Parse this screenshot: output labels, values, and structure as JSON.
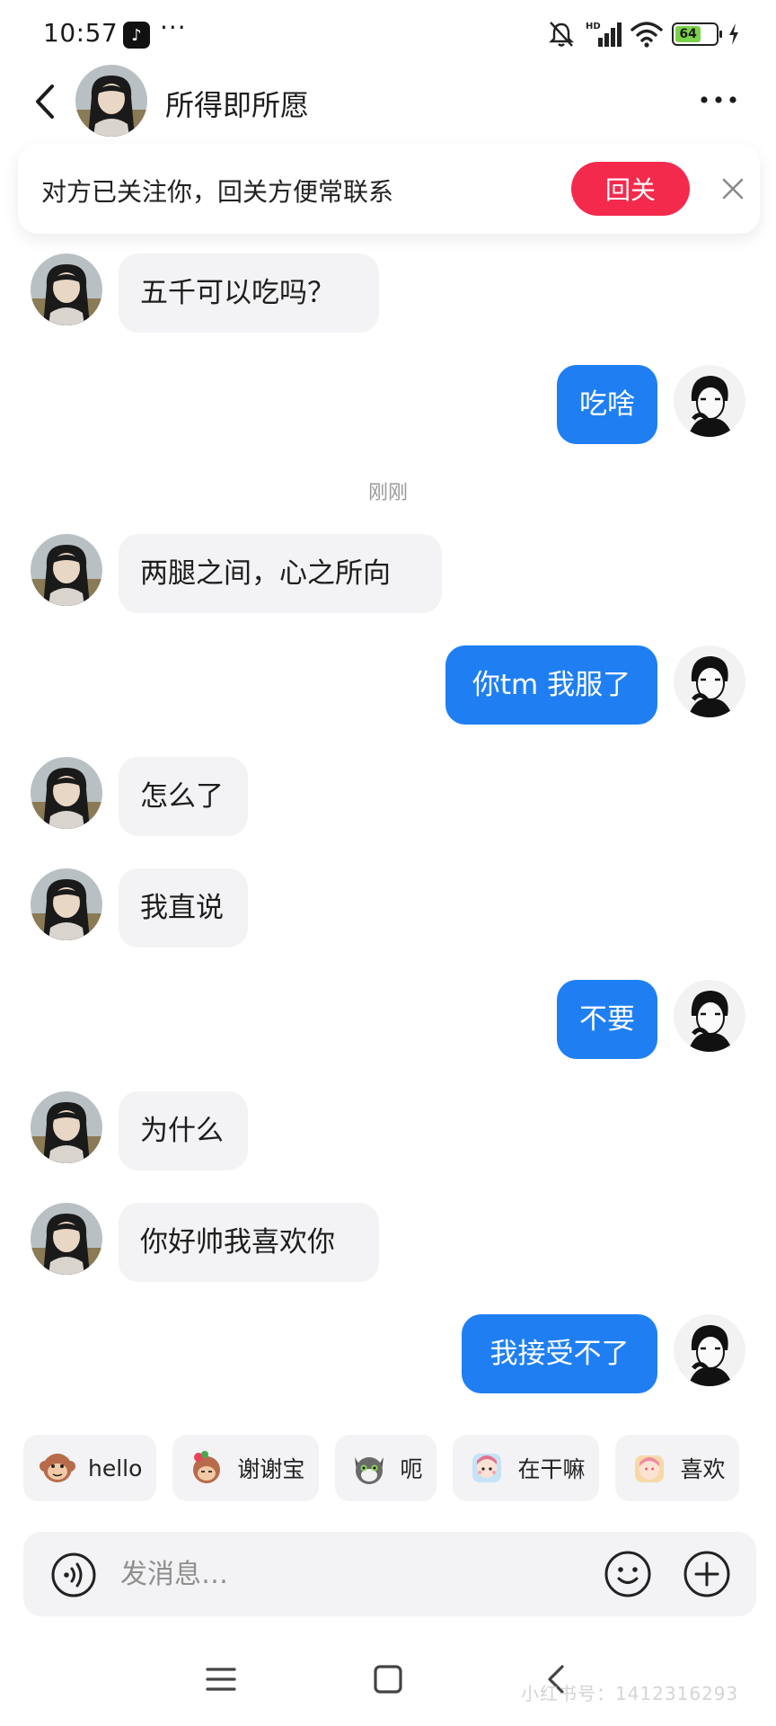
{
  "status_bar": {
    "time": "10:57",
    "app_badge": "♪",
    "more": "···",
    "network": "HD",
    "battery": "64",
    "battery_level": 0.64
  },
  "header": {
    "contact_name": "所得即所愿"
  },
  "follow_banner": {
    "text": "对方已关注你，回关方便常联系",
    "button_label": "回关",
    "accent_color": "#f42a4d"
  },
  "messages": [
    {
      "from": "them",
      "text": "五千可以吃吗？"
    },
    {
      "from": "me",
      "text": "吃啥"
    },
    {
      "from": "them",
      "text": "两腿之间，心之所向"
    },
    {
      "from": "me",
      "text": "你tm 我服了"
    },
    {
      "from": "them",
      "text": "怎么了"
    },
    {
      "from": "them",
      "text": "我直说"
    },
    {
      "from": "me",
      "text": "不要"
    },
    {
      "from": "them",
      "text": "为什么"
    },
    {
      "from": "them",
      "text": "你好帅我喜欢你"
    },
    {
      "from": "me",
      "text": "我接受不了"
    }
  ],
  "timestamp": "刚刚",
  "quick_replies": [
    {
      "label": "hello",
      "icon": "monkey-sticker"
    },
    {
      "label": "谢谢宝",
      "icon": "bowing-monkey-sticker"
    },
    {
      "label": "呃",
      "icon": "cat-sticker"
    },
    {
      "label": "在干嘛",
      "icon": "girl-sticker"
    },
    {
      "label": "喜欢",
      "icon": "love-girl-sticker"
    }
  ],
  "input": {
    "placeholder": "发消息…"
  },
  "watermark": "小红书号：1412316293",
  "colors": {
    "outgoing_bubble": "#1f7ff2",
    "incoming_bubble": "#f3f3f5"
  }
}
